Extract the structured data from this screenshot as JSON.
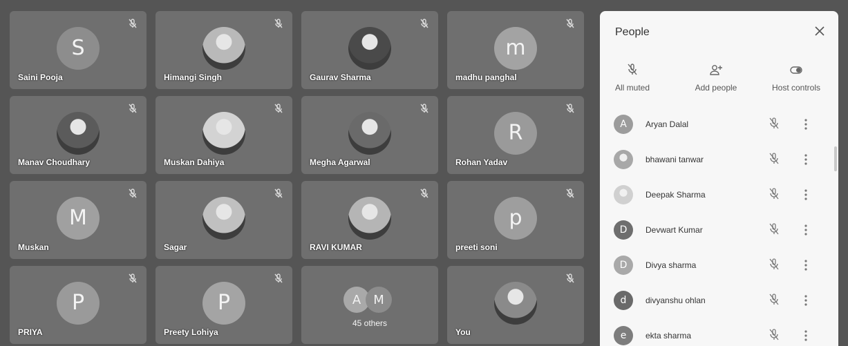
{
  "tiles": [
    {
      "name": "Saini Pooja",
      "initial": "S",
      "avatar_color": "#8d8d8d",
      "photo": false
    },
    {
      "name": "Himangi Singh",
      "initial": "",
      "avatar_color": "#b9b9b9",
      "photo": true
    },
    {
      "name": "Gaurav Sharma",
      "initial": "",
      "avatar_color": "#4a4a4a",
      "photo": true
    },
    {
      "name": "madhu panghal",
      "initial": "m",
      "avatar_color": "#a3a3a3",
      "photo": false
    },
    {
      "name": "Manav Choudhary",
      "initial": "",
      "avatar_color": "#5b5b5b",
      "photo": true
    },
    {
      "name": "Muskan Dahiya",
      "initial": "",
      "avatar_color": "#d3d3d3",
      "photo": true
    },
    {
      "name": "Megha Agarwal",
      "initial": "",
      "avatar_color": "#6a6a6a",
      "photo": true
    },
    {
      "name": "Rohan Yadav",
      "initial": "R",
      "avatar_color": "#9a9a9a",
      "photo": false
    },
    {
      "name": "Muskan",
      "initial": "M",
      "avatar_color": "#a0a0a0",
      "photo": false
    },
    {
      "name": "Sagar",
      "initial": "",
      "avatar_color": "#c0c0c0",
      "photo": true
    },
    {
      "name": "RAVI KUMAR",
      "initial": "",
      "avatar_color": "#b5b5b5",
      "photo": true
    },
    {
      "name": "preeti soni",
      "initial": "p",
      "avatar_color": "#9e9e9e",
      "photo": false
    },
    {
      "name": "PRIYA",
      "initial": "P",
      "avatar_color": "#9a9a9a",
      "photo": false
    },
    {
      "name": "Preety Lohiya",
      "initial": "P",
      "avatar_color": "#a4a4a4",
      "photo": false
    },
    {
      "name": "",
      "initial": "",
      "avatar_color": "",
      "photo": false
    },
    {
      "name": "You",
      "initial": "",
      "avatar_color": "#8a8a8a",
      "photo": true
    }
  ],
  "others": {
    "initials": [
      "A",
      "M"
    ],
    "colors": [
      "#a9a9a9",
      "#8c8c8c"
    ],
    "label": "45 others"
  },
  "panel": {
    "title": "People",
    "actions": [
      {
        "label": "All muted",
        "icon": "mic-off-icon"
      },
      {
        "label": "Add people",
        "icon": "add-person-icon"
      },
      {
        "label": "Host controls",
        "icon": "toggle-icon"
      }
    ],
    "participants": [
      {
        "name": "Aryan Dalal",
        "initial": "A",
        "color": "#9c9c9c",
        "photo": false
      },
      {
        "name": "bhawani tanwar",
        "initial": "",
        "color": "#a8a8a8",
        "photo": true
      },
      {
        "name": "Deepak Sharma",
        "initial": "",
        "color": "#d0d0d0",
        "photo": true
      },
      {
        "name": "Devwart Kumar",
        "initial": "D",
        "color": "#6e6e6e",
        "photo": false
      },
      {
        "name": "Divya sharma",
        "initial": "D",
        "color": "#a9a9a9",
        "photo": false
      },
      {
        "name": "divyanshu ohlan",
        "initial": "d",
        "color": "#6a6a6a",
        "photo": false
      },
      {
        "name": "ekta sharma",
        "initial": "e",
        "color": "#7d7d7d",
        "photo": false
      }
    ]
  }
}
